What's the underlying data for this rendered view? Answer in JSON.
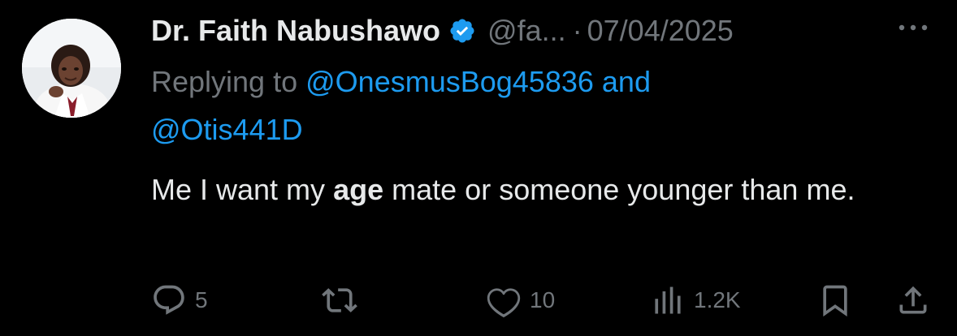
{
  "tweet": {
    "display_name": "Dr. Faith Nabushawo",
    "handle": "@fa...",
    "separator": "·",
    "date": "07/04/2025",
    "replying_prefix": "Replying to",
    "reply_mention_1": "@OnesmusBog45836",
    "reply_joiner": "and",
    "reply_mention_2": "@Otis441D",
    "text_before_bold": "Me I want my",
    "text_bold": "age",
    "text_after_bold": "mate or someone younger than me."
  },
  "actions": {
    "reply_count": "5",
    "like_count": "10",
    "views_count": "1.2K"
  },
  "icons": {
    "verified": "verified-badge-icon",
    "more": "more-dots-icon",
    "reply": "comment-bubble-icon",
    "retweet": "retweet-icon",
    "like": "heart-icon",
    "views": "analytics-bars-icon",
    "bookmark": "bookmark-icon",
    "share": "share-upload-icon"
  },
  "colors": {
    "background": "#000000",
    "primary_text": "#e7e9ea",
    "secondary_text": "#71767b",
    "accent": "#1d9bf0"
  }
}
